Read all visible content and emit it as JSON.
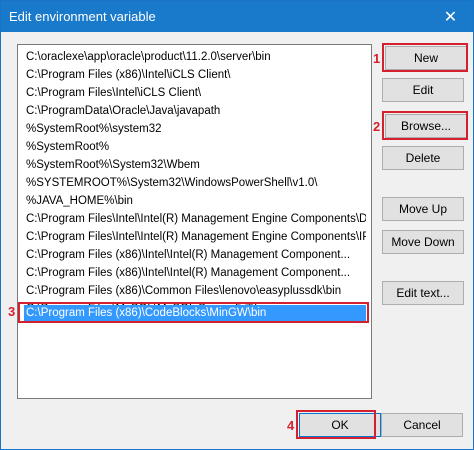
{
  "window": {
    "title": "Edit environment variable",
    "close_glyph": "✕"
  },
  "path_list": {
    "items": [
      "C:\\oraclexe\\app\\oracle\\product\\11.2.0\\server\\bin",
      "C:\\Program Files (x86)\\Intel\\iCLS Client\\",
      "C:\\Program Files\\Intel\\iCLS Client\\",
      "C:\\ProgramData\\Oracle\\Java\\javapath",
      "%SystemRoot%\\system32",
      "%SystemRoot%",
      "%SystemRoot%\\System32\\Wbem",
      "%SYSTEMROOT%\\System32\\WindowsPowerShell\\v1.0\\",
      "%JAVA_HOME%\\bin",
      "C:\\Program Files\\Intel\\Intel(R) Management Engine Components\\DAL",
      "C:\\Program Files\\Intel\\Intel(R) Management Engine Components\\IPT",
      "C:\\Program Files (x86)\\Intel\\Intel(R) Management Component...",
      "C:\\Program Files (x86)\\Intel\\Intel(R) Management Component...",
      "C:\\Program Files (x86)\\Common Files\\lenovo\\easyplussdk\\bin",
      "C:\\Program Files\\MySQL\\MySQL Server 5.7\\bin",
      "C:\\Program Files (x86)\\CodeBlocks\\MinGW\\bin"
    ],
    "selected_index": 15
  },
  "buttons": {
    "new": "New",
    "edit": "Edit",
    "browse": "Browse...",
    "delete": "Delete",
    "move_up": "Move Up",
    "move_down": "Move Down",
    "edit_text": "Edit text...",
    "ok": "OK",
    "cancel": "Cancel"
  },
  "annotations": {
    "step1": "1",
    "step2": "2",
    "step3": "3",
    "step4": "4",
    "color": "#d5212f"
  },
  "colors": {
    "titlebar": "#1979ca",
    "selection": "#3399ff",
    "button_face": "#e1e1e1"
  }
}
